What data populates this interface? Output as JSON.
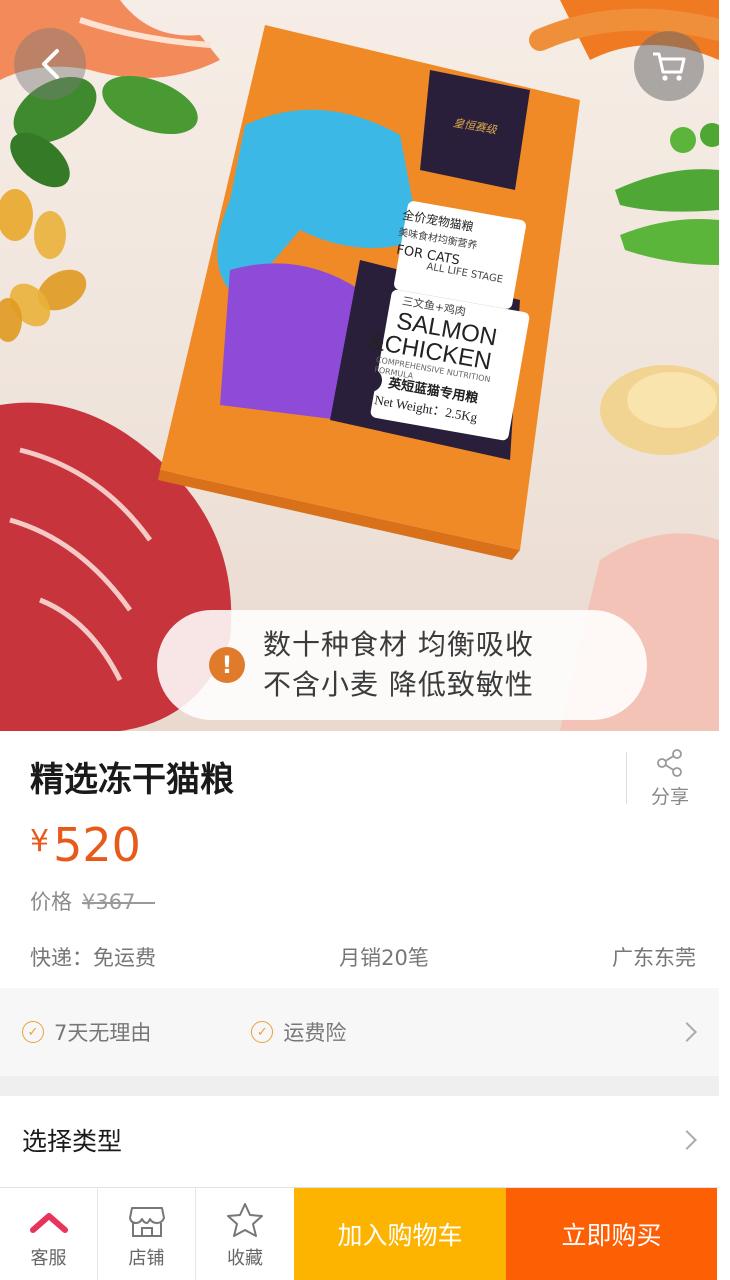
{
  "hero": {
    "package": {
      "brand_badge": "皇恒赛级",
      "label_cn": "全价宠物猫粮",
      "label_sub": "美味食材均衡营养",
      "for_cats": "FOR CATS",
      "life_stage": "ALL LIFE STAGE",
      "flavor_cn": "三文鱼+鸡肉",
      "flavor_1": "SALMON",
      "flavor_2": "&CHICKEN",
      "formula": "COMPREHENSIVE NUTRITION FORMULA",
      "breed": "英短蓝猫专用粮",
      "weight": "Net Weight：2.5Kg"
    },
    "banner_line1": "数十种食材 均衡吸收",
    "banner_line2": "不含小麦 降低致敏性",
    "banner_icon": "exclamation-icon"
  },
  "product": {
    "title": "精选冻干猫粮",
    "share_label": "分享",
    "currency": "¥",
    "price": "520",
    "old_price_label": "价格",
    "old_price": "¥367"
  },
  "meta": {
    "shipping": "快递：免运费",
    "monthly_sales": "月销20笔",
    "location": "广东东莞"
  },
  "guarantees": [
    "7天无理由",
    "运费险"
  ],
  "select_type_label": "选择类型",
  "bottom_bar": {
    "service_label": "客服",
    "shop_label": "店铺",
    "favorite_label": "收藏",
    "add_to_cart": "加入购物车",
    "buy_now": "立即购买"
  },
  "colors": {
    "accent_orange": "#e85a1c",
    "cart_button": "#fdb400",
    "buy_button": "#fd5f05",
    "service_icon": "#e8335b",
    "check_color": "#e7a23a"
  }
}
